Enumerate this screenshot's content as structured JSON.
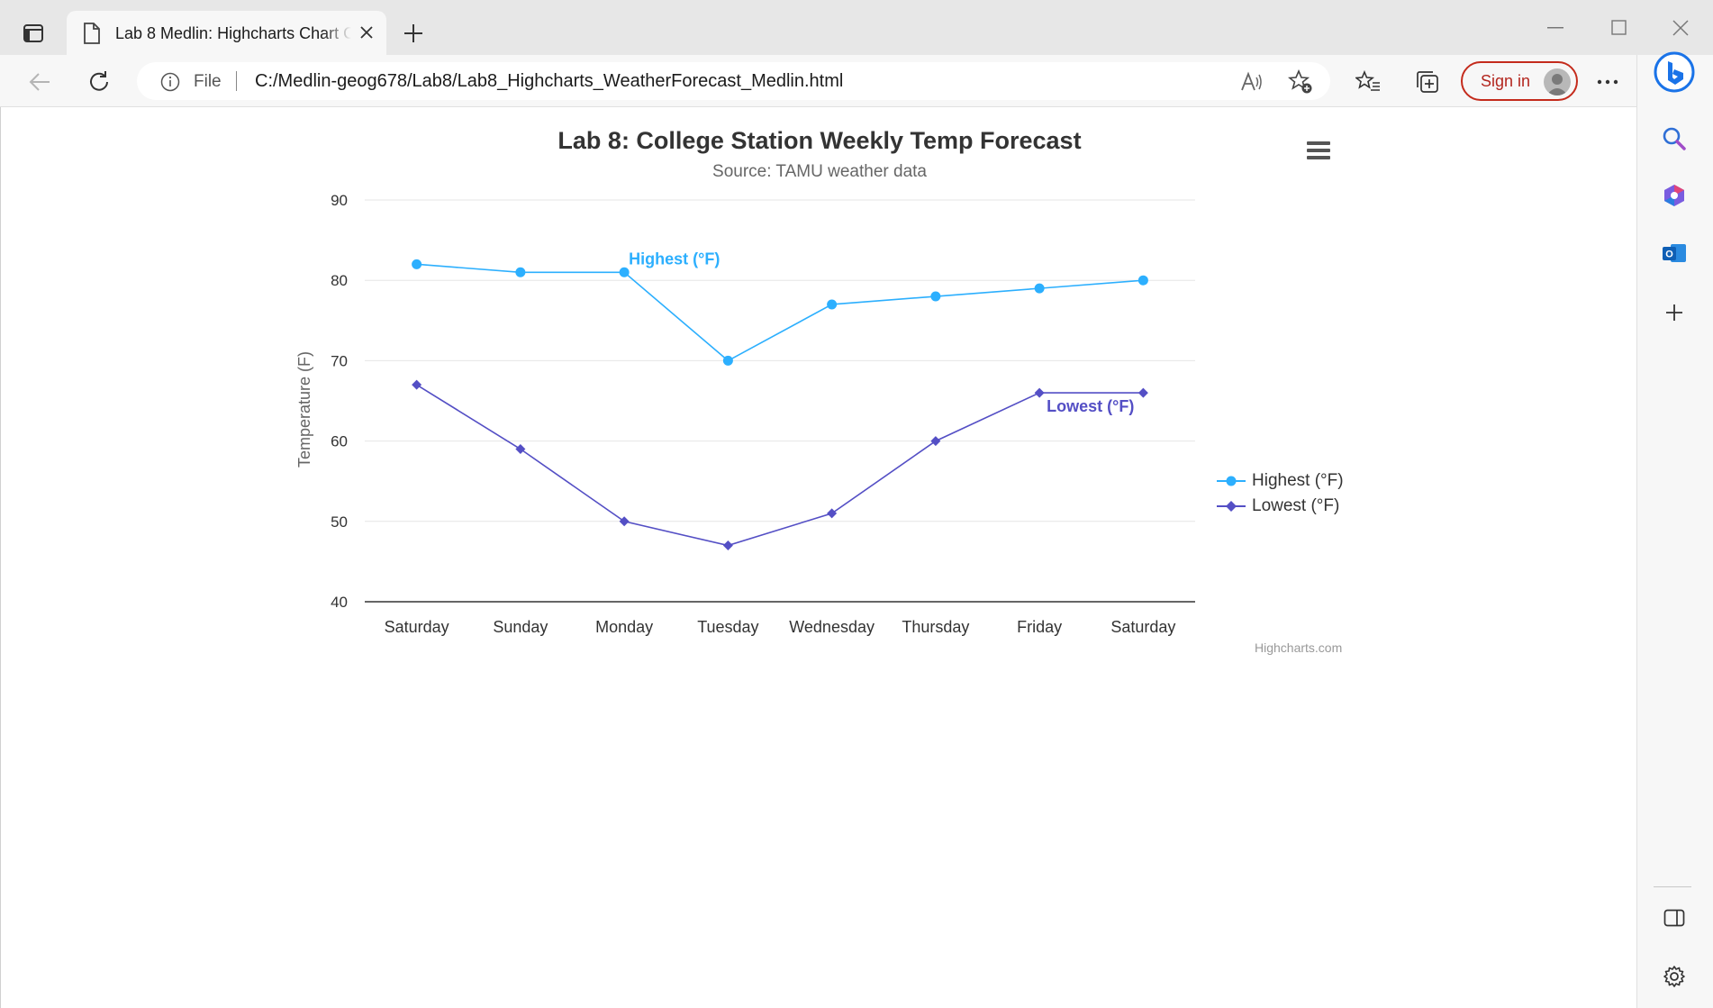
{
  "window": {
    "tab_title": "Lab 8 Medlin: Highcharts Chart C",
    "address_scheme": "File",
    "url": "C:/Medlin-geog678/Lab8/Lab8_Highcharts_WeatherForecast_Medlin.html",
    "signin_label": "Sign in"
  },
  "icons": {
    "tab_actions": "tab-actions-icon",
    "page": "page-icon",
    "close": "close-icon",
    "new_tab": "plus-icon",
    "minimize": "minimize-icon",
    "maximize": "maximize-icon",
    "window_close": "window-close-icon",
    "back": "back-arrow-icon",
    "refresh": "refresh-icon",
    "info": "info-icon",
    "read_aloud": "read-aloud-icon",
    "add_favorite": "star-add-icon",
    "favorites": "favorites-icon",
    "collections": "collections-icon",
    "more": "more-icon",
    "copilot": "copilot-icon",
    "search": "search-icon",
    "microsoft365": "microsoft365-icon",
    "outlook": "outlook-icon",
    "add_app": "plus-icon",
    "sidebar_toggle": "sidebar-icon",
    "settings": "gear-icon",
    "chart_menu": "hamburger-menu-icon"
  },
  "colors": {
    "highest_series": "#2caffe",
    "lowest_series": "#544fc5",
    "signin_accent": "#c42b1c"
  },
  "chart_data": {
    "type": "line",
    "title": "Lab 8: College Station Weekly Temp Forecast",
    "subtitle": "Source: TAMU weather data",
    "xlabel": "",
    "ylabel": "Temperature (F)",
    "categories": [
      "Saturday",
      "Sunday",
      "Monday",
      "Tuesday",
      "Wednesday",
      "Thursday",
      "Friday",
      "Saturday"
    ],
    "y_ticks": [
      "90",
      "80",
      "70",
      "60",
      "50",
      "40"
    ],
    "ylim": [
      40,
      90
    ],
    "grid": true,
    "legend_position": "right",
    "series": [
      {
        "name": "Highest (°F)",
        "values": [
          82,
          81,
          81,
          70,
          77,
          78,
          79,
          80
        ],
        "marker": "circle",
        "color": "#2caffe",
        "data_label": "Highest (°F)",
        "label_at_index": 2
      },
      {
        "name": "Lowest (°F)",
        "values": [
          67,
          59,
          50,
          47,
          51,
          60,
          66,
          66
        ],
        "marker": "diamond",
        "color": "#544fc5",
        "data_label": "Lowest (°F)",
        "label_at_index": 6
      }
    ],
    "credits": "Highcharts.com"
  }
}
